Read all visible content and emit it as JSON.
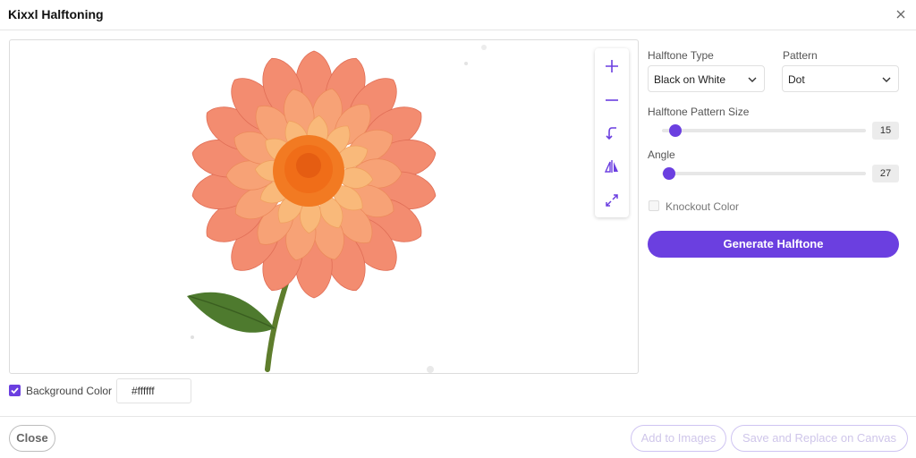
{
  "window": {
    "title": "Kixxl Halftoning"
  },
  "icons": {
    "close": "close-icon",
    "zoom_in": "plus-icon",
    "zoom_out": "minus-icon",
    "rotate": "rotate-icon",
    "flip": "flip-icon",
    "fit": "expand-icon",
    "chevron": "chevron-down-icon",
    "checkbox": "check-icon"
  },
  "background": {
    "label": "Background Color",
    "checked": true,
    "value": "#ffffff"
  },
  "controls": {
    "halftone_type": {
      "label": "Halftone Type",
      "value": "Black on White"
    },
    "pattern": {
      "label": "Pattern",
      "value": "Dot"
    },
    "pattern_size": {
      "label": "Halftone Pattern Size",
      "value": "15"
    },
    "angle": {
      "label": "Angle",
      "value": "27"
    },
    "knockout": {
      "label": "Knockout Color",
      "checked": false
    }
  },
  "buttons": {
    "generate": "Generate Halftone",
    "close": "Close",
    "add_images": "Add to Images",
    "save_replace": "Save and Replace on Canvas"
  },
  "colors": {
    "accent": "#6b3fe0",
    "petal": "#f28a6e",
    "center": "#f57c1f",
    "leaf": "#4e7a2e"
  }
}
